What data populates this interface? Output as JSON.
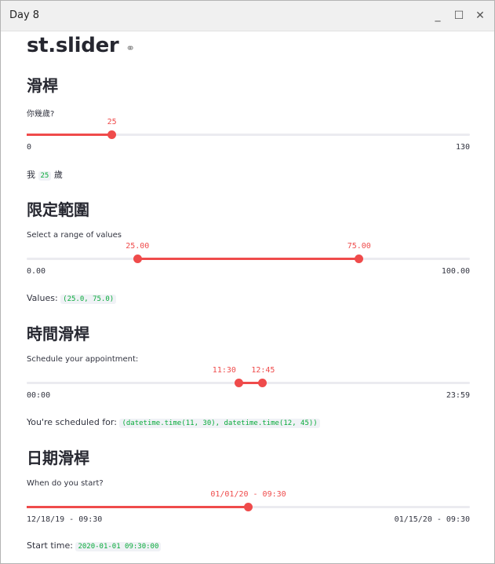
{
  "window": {
    "title": "Day 8",
    "minimize_glyph": "_",
    "maximize_glyph": "☐",
    "close_glyph": "✕"
  },
  "page": {
    "title": "st.slider",
    "anchor_icon": "link-icon",
    "anchor_glyph": "⚭"
  },
  "sections": {
    "slider": {
      "heading": "滑桿",
      "label": "你幾歲?",
      "value": "25",
      "min": "0",
      "max": "130",
      "value_fraction": 0.1923,
      "output_prefix": "我",
      "output_value": "25",
      "output_suffix": "歲"
    },
    "range": {
      "heading": "限定範圍",
      "label": "Select a range of values",
      "low": "25.00",
      "high": "75.00",
      "min": "0.00",
      "max": "100.00",
      "low_fraction": 0.25,
      "high_fraction": 0.75,
      "output_prefix": "Values:",
      "output_value": "(25.0, 75.0)"
    },
    "time": {
      "heading": "時間滑桿",
      "label": "Schedule your appointment:",
      "low": "11:30",
      "high": "12:45",
      "min": "00:00",
      "max": "23:59",
      "low_fraction": 0.4795,
      "high_fraction": 0.5316,
      "output_prefix": "You're scheduled for:",
      "output_value": "(datetime.time(11, 30), datetime.time(12, 45))"
    },
    "date": {
      "heading": "日期滑桿",
      "label": "When do you start?",
      "value": "01/01/20 - 09:30",
      "min": "12/18/19 - 09:30",
      "max": "01/15/20 - 09:30",
      "value_fraction": 0.5,
      "output_prefix": "Start time:",
      "output_value": "2020-01-01 09:30:00"
    }
  },
  "colors": {
    "accent": "#ef4b4b",
    "track": "#ebebf0",
    "code_text": "#09ab3b",
    "code_bg": "#f0f2f6"
  }
}
